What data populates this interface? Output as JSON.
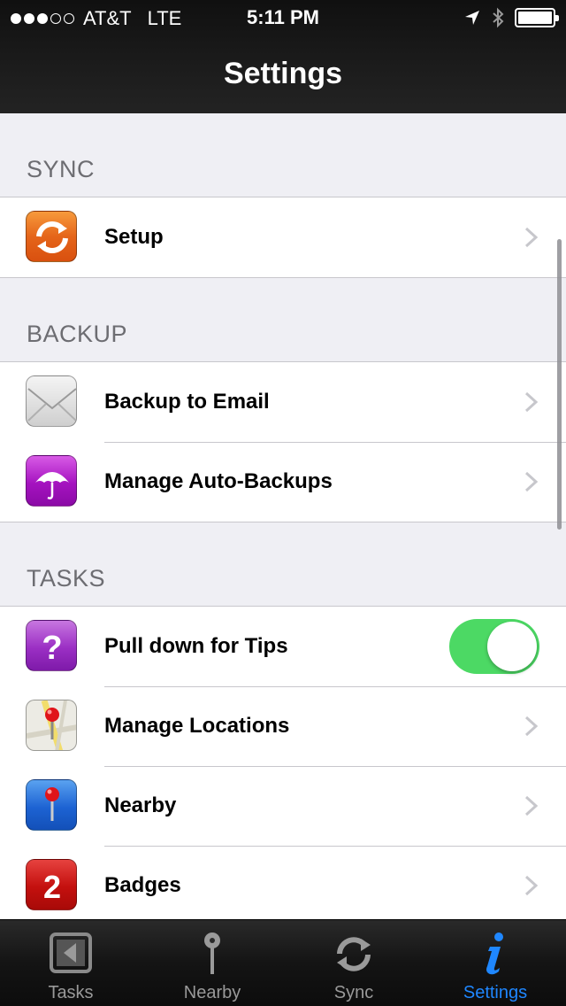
{
  "status_bar": {
    "carrier": "AT&T",
    "network": "LTE",
    "time": "5:11 PM",
    "signal_bars": 3,
    "signal_max": 5
  },
  "nav": {
    "title": "Settings"
  },
  "sections": {
    "sync": {
      "header": "SYNC",
      "setup": {
        "label": "Setup",
        "icon": "sync-icon"
      }
    },
    "backup": {
      "header": "BACKUP",
      "email": {
        "label": "Backup to Email",
        "icon": "envelope-icon"
      },
      "auto": {
        "label": "Manage Auto-Backups",
        "icon": "umbrella-icon"
      }
    },
    "tasks": {
      "header": "TASKS",
      "tips": {
        "label": "Pull down for Tips",
        "icon": "question-icon",
        "toggle_on": true
      },
      "locations": {
        "label": "Manage Locations",
        "icon": "map-pin-icon"
      },
      "nearby": {
        "label": "Nearby",
        "icon": "pin-icon"
      },
      "badges": {
        "label": "Badges",
        "icon": "badge-icon",
        "badge_number": "2"
      }
    }
  },
  "tabs": {
    "tasks": {
      "label": "Tasks"
    },
    "nearby": {
      "label": "Nearby"
    },
    "sync": {
      "label": "Sync"
    },
    "settings": {
      "label": "Settings",
      "active": true
    }
  },
  "colors": {
    "accent": "#1f87ff",
    "toggle_on": "#4cd964",
    "background": "#efeff4"
  }
}
